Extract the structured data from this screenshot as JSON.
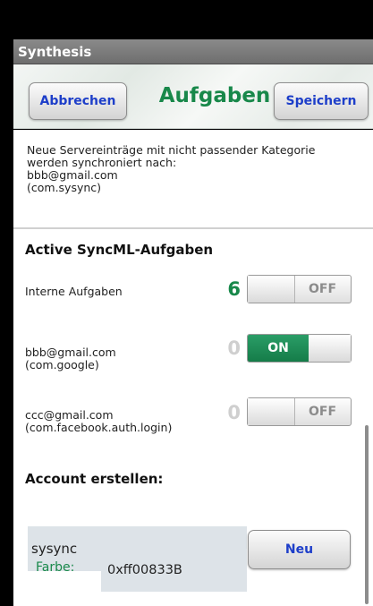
{
  "app": {
    "title": "Synthesis"
  },
  "header": {
    "cancel_label": "Abbrechen",
    "title": "Aufgaben",
    "save_label": "Speichern"
  },
  "info": {
    "line1": "Neue Servereinträge mit nicht passender Kategorie",
    "line2": "werden synchroniert nach:",
    "line3": "bbb@gmail.com",
    "line4": "(com.sysync)"
  },
  "sync": {
    "title": "Active SyncML-Aufgaben",
    "rows": [
      {
        "label": "Interne Aufgaben",
        "sublabel": "",
        "count": "6",
        "toggle": "OFF",
        "on": false,
        "count_color": "#18884a"
      },
      {
        "label": "bbb@gmail.com",
        "sublabel": "(com.google)",
        "count": "0",
        "toggle": "ON",
        "on": true,
        "count_color": "#cfcfcf"
      },
      {
        "label": "ccc@gmail.com",
        "sublabel": "(com.facebook.auth.login)",
        "count": "0",
        "toggle": "OFF",
        "on": false,
        "count_color": "#cfcfcf"
      }
    ]
  },
  "account": {
    "title": "Account erstellen:",
    "name_value": "sysync",
    "new_label": "Neu",
    "color_label": "Farbe:",
    "color_value": "0xff00833B"
  },
  "colors": {
    "accent_green": "#18884a",
    "button_text_blue": "#1d3ec9",
    "toggle_on_green": "#1a8a55",
    "field_bg": "#dde3e8"
  }
}
